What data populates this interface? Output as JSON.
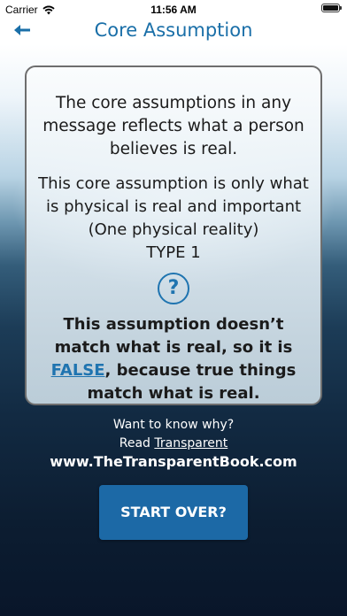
{
  "status_bar": {
    "carrier": "Carrier",
    "time": "11:56 AM"
  },
  "nav": {
    "title": "Core Assumption",
    "back_icon": "arrow-left-icon"
  },
  "card": {
    "intro": "The core assumptions in any message reflects what a person believes is real.",
    "assumption_line1": "This core assumption is only what is physical is real and important",
    "assumption_line2": "(One physical reality)",
    "type_label": "TYPE 1",
    "help_icon": "question-circle-icon",
    "help_symbol": "?",
    "verdict_before": "This assumption doesn’t match what is real, so it is ",
    "verdict_link": "FALSE",
    "verdict_after": ", because true things match what is real."
  },
  "footer": {
    "want_text": "Want to know why?",
    "read_prefix": "Read ",
    "read_link": "Transparent",
    "website": "www.TheTransparentBook.com",
    "start_over_label": "START OVER?"
  },
  "colors": {
    "accent": "#1f74b0",
    "button": "#1c69a6",
    "title": "#1a6fa8"
  }
}
